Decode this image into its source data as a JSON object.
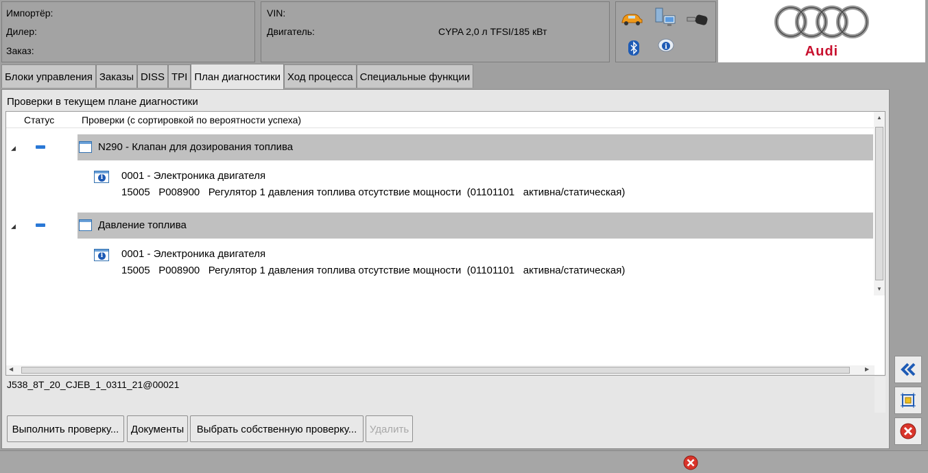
{
  "header": {
    "importer_label": "Импортёр:",
    "dealer_label": "Дилер:",
    "order_label": "Заказ:",
    "vin_label": "VIN:",
    "engine_label": "Двигатель:",
    "engine_value": "CYPA 2,0 л TFSI/185 кВт",
    "brand": "Audi"
  },
  "tabs": [
    {
      "label": "Блоки управления"
    },
    {
      "label": "Заказы"
    },
    {
      "label": "DISS"
    },
    {
      "label": "TPI"
    },
    {
      "label": "План диагностики",
      "active": true
    },
    {
      "label": "Ход процесса"
    },
    {
      "label": "Специальные функции"
    }
  ],
  "content": {
    "section_title": "Проверки в текущем плане диагностики",
    "columns": {
      "status": "Статус",
      "checks": "Проверки (с сортировкой по вероятности успеха)"
    },
    "groups": [
      {
        "title": "N290 - Клапан для дозирования топлива",
        "module": "0001 - Электроника двигателя",
        "fault": "15005   P008900   Регулятор 1 давления топлива отсутствие мощности  (01101101   активна/статическая)"
      },
      {
        "title": "Давление топлива",
        "module": "0001 - Электроника двигателя",
        "fault": "15005   P008900   Регулятор 1 давления топлива отсутствие мощности  (01101101   активна/статическая)"
      }
    ],
    "info_text": "J538_8T_20_CJEB_1_0311_21@00021"
  },
  "buttons": {
    "run": "Выполнить проверку...",
    "documents": "Документы",
    "choose_own": "Выбрать собственную проверку...",
    "delete": "Удалить"
  },
  "colors": {
    "accent": "#2a78d6",
    "group_bg": "#c0c0c0",
    "close_red": "#d9352b"
  }
}
